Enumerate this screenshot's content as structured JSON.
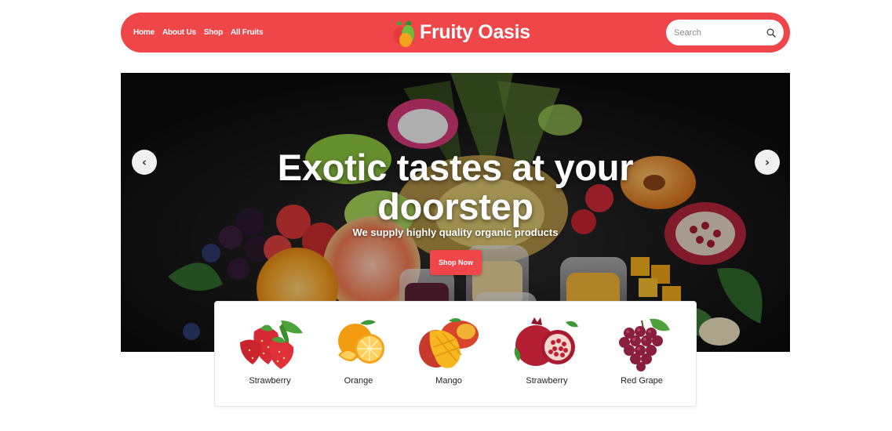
{
  "nav": {
    "links": [
      "Home",
      "About Us",
      "Shop",
      "All Fruits"
    ],
    "brand": "Fruity Oasis",
    "search_placeholder": "Search"
  },
  "hero": {
    "title_line1": "Exotic tastes at your",
    "title_line2": "doorstep",
    "subtitle": "We supply highly quality organic products",
    "cta": "Shop Now",
    "prev_arrow": "‹",
    "next_arrow": "›"
  },
  "categories": [
    {
      "label": "Strawberry",
      "icon": "strawberry-icon"
    },
    {
      "label": "Orange",
      "icon": "orange-icon"
    },
    {
      "label": "Mango",
      "icon": "mango-icon"
    },
    {
      "label": "Strawberry",
      "icon": "pomegranate-icon"
    },
    {
      "label": "Red Grape",
      "icon": "grape-icon"
    }
  ],
  "colors": {
    "brand_red": "#ef4649",
    "hero_background": "#141414",
    "white": "#ffffff"
  }
}
